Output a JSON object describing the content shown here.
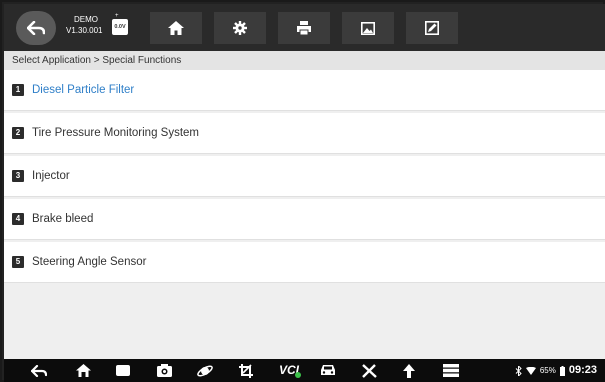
{
  "toolbar": {
    "demo_line1": "DEMO",
    "demo_line2": "V1.30.001",
    "battery_voltage": "0.0V",
    "buttons": [
      {
        "name": "home-button",
        "icon": "home-icon"
      },
      {
        "name": "settings-button",
        "icon": "gear-icon"
      },
      {
        "name": "print-button",
        "icon": "printer-icon"
      },
      {
        "name": "screenshot-button",
        "icon": "image-icon"
      },
      {
        "name": "edit-button",
        "icon": "edit-icon"
      }
    ]
  },
  "breadcrumb": "Select Application > Special Functions",
  "items": [
    {
      "num": "1",
      "label": "Diesel Particle Filter",
      "active": true
    },
    {
      "num": "2",
      "label": "Tire Pressure Monitoring System",
      "active": false
    },
    {
      "num": "3",
      "label": "Injector",
      "active": false
    },
    {
      "num": "4",
      "label": "Brake bleed",
      "active": false
    },
    {
      "num": "5",
      "label": "Steering Angle Sensor",
      "active": false
    }
  ],
  "navbar": {
    "vci_label": "VCI",
    "battery_percent": "65%",
    "time": "09:23"
  },
  "colors": {
    "accent": "#2f7fc8",
    "vci_connected": "#3cc24a"
  }
}
